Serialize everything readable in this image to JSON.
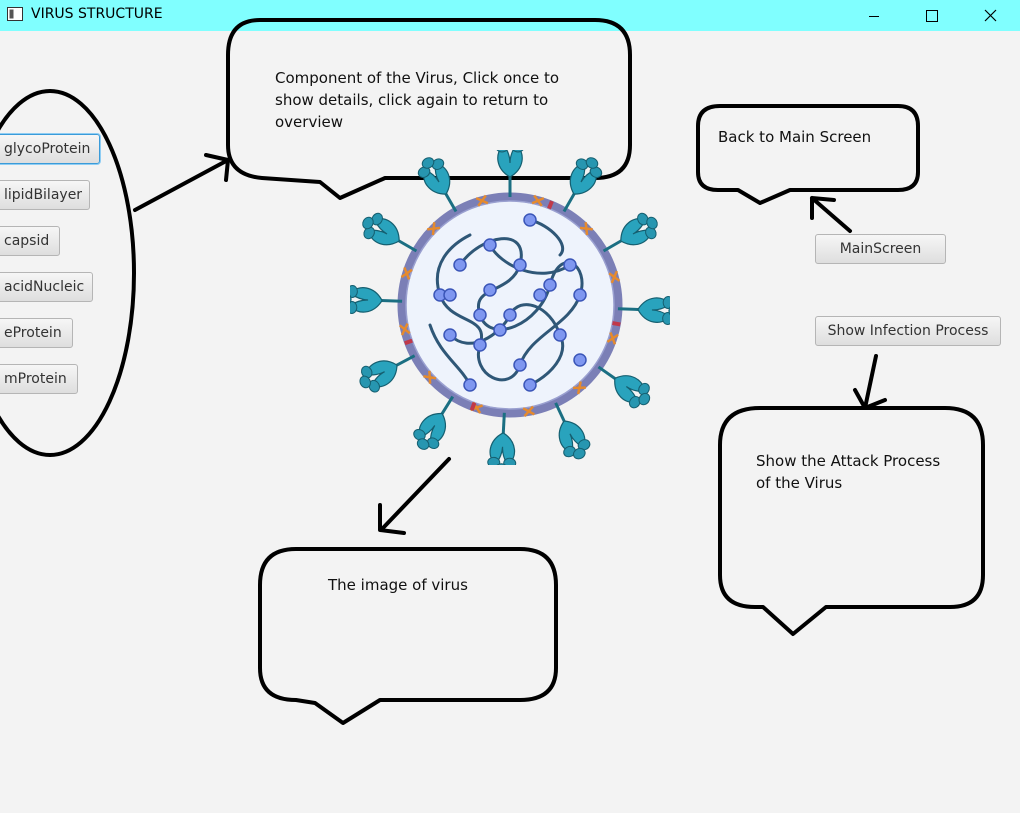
{
  "window": {
    "title": "VIRUS STRUCTURE"
  },
  "components": {
    "items": [
      "glycoProtein",
      "lipidBilayer",
      "capsid",
      "acidNucleic",
      "eProtein",
      "mProtein"
    ]
  },
  "actions": {
    "main_screen_label": "MainScreen",
    "infection_label": "Show Infection Process"
  },
  "notes": {
    "components_note": "Component of the Virus, Click once to show details, click again to return to overview",
    "main_screen_note": "Back to Main Screen",
    "infection_note": "Show the Attack Process of the Virus",
    "image_note": "The image of virus"
  },
  "colors": {
    "titlebar": "#80ffff",
    "virus_envelope": "#7b7fb6",
    "virus_inner": "#eef3fc",
    "spike": "#29a3bd",
    "nucleic_dot": "#7f97f0",
    "membrane_protein": "#e58a2e"
  }
}
